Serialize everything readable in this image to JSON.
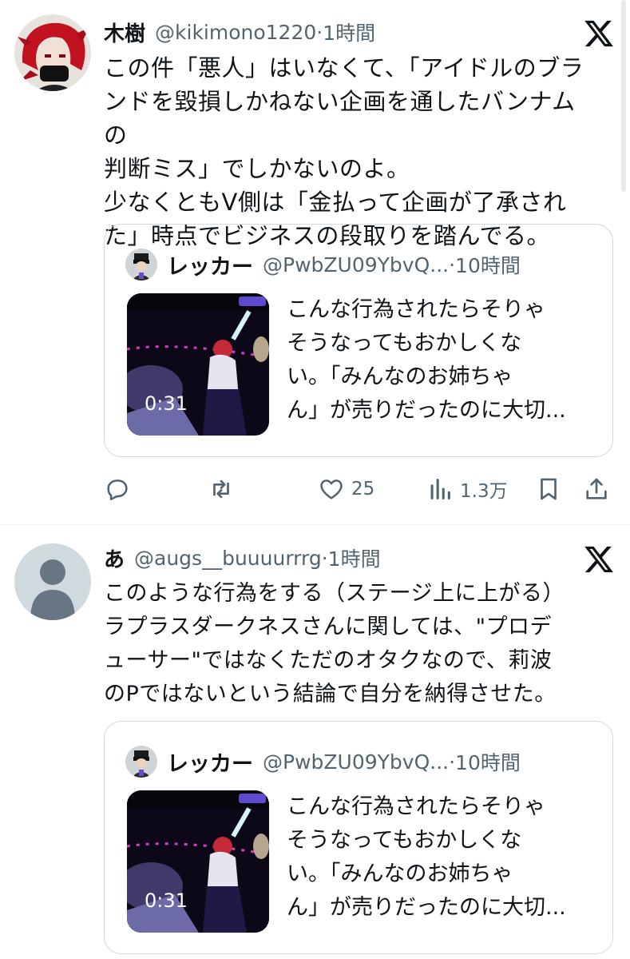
{
  "tweets": [
    {
      "name": "木樹",
      "handle": "@kikimono1220",
      "time": "1時間",
      "lines": [
        "この件「悪人」はいなくて、「アイドルのブラ",
        "ンドを毀損しかねない企画を通したバンナムの",
        "判断ミス」でしかないのよ。",
        "少なくともV側は「金払って企画が了承され",
        "た」時点でビジネスの段取りを踏んでる。"
      ],
      "quote": {
        "name": "レッカー",
        "handle": "@PwbZU09YbvQ...",
        "time": "10時間",
        "duration": "0:31",
        "lines": [
          "こんな行為されたらそりゃ",
          "そうなってもおかしくな",
          "い。「みんなのお姉ちゃ",
          "ん」が売りだったのに大切..."
        ]
      },
      "actions": {
        "likes": "25",
        "views": "1.3万"
      }
    },
    {
      "name": "あ",
      "handle": "@augs__buuuurrrg",
      "time": "1時間",
      "lines": [
        "このような行為をする（ステージ上に上がる）",
        "ラプラスダークネスさんに関しては、\"プロデ",
        "ューサー\"ではなくただのオタクなので、莉波",
        "のPではないという結論で自分を納得させた。"
      ],
      "quote": {
        "name": "レッカー",
        "handle": "@PwbZU09YbvQ...",
        "time": "10時間",
        "duration": "0:31",
        "lines": [
          "こんな行為されたらそりゃ",
          "そうなってもおかしくな",
          "い。「みんなのお姉ちゃ",
          "ん」が売りだったのに大切..."
        ]
      }
    }
  ],
  "separator": " · ",
  "icons": [
    "reply-icon",
    "retweet-icon",
    "like-icon",
    "views-icon",
    "bookmark-icon",
    "share-icon",
    "x-logo-icon"
  ],
  "colors": {
    "text": "#0f1419",
    "secondary": "#536471",
    "border": "#cfd9de"
  }
}
